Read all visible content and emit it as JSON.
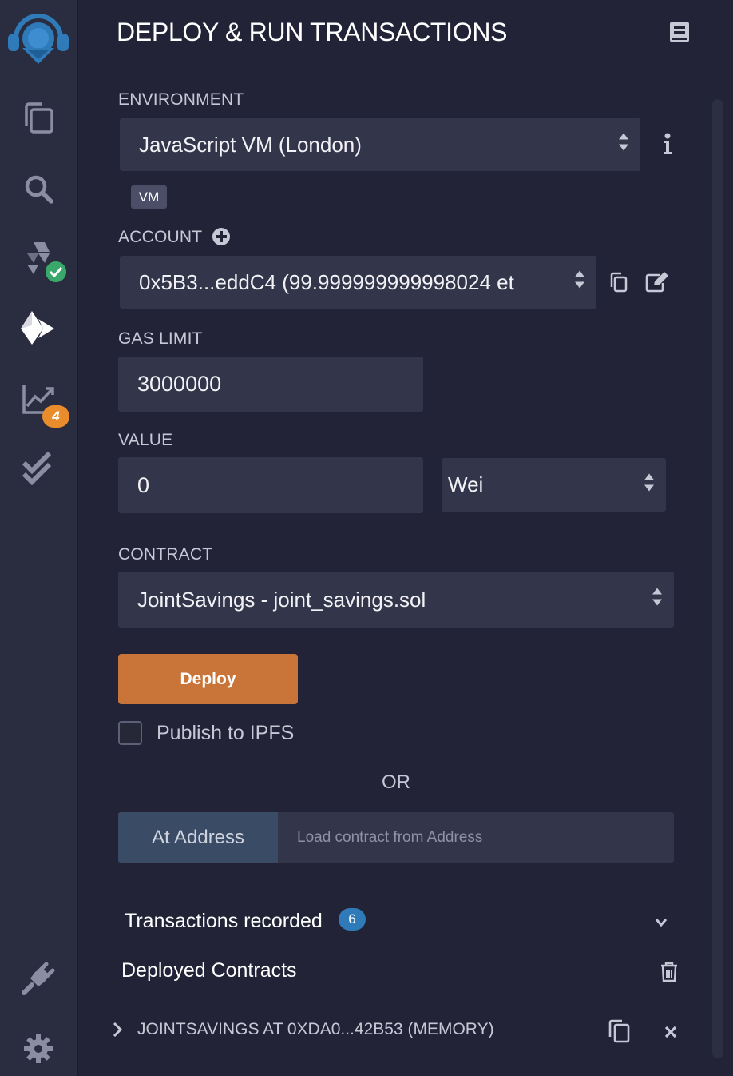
{
  "sidebar": {
    "items": [
      {
        "name": "logo"
      },
      {
        "name": "file-explorer"
      },
      {
        "name": "search"
      },
      {
        "name": "solidity-compiler"
      },
      {
        "name": "deploy-run"
      },
      {
        "name": "analysis",
        "badge": "4"
      },
      {
        "name": "unit-testing"
      },
      {
        "name": "plugin-manager"
      },
      {
        "name": "settings"
      }
    ]
  },
  "header": {
    "title": "DEPLOY & RUN TRANSACTIONS"
  },
  "environment": {
    "label": "ENVIRONMENT",
    "value": "JavaScript VM (London)",
    "badge": "VM"
  },
  "account": {
    "label": "ACCOUNT",
    "value": "0x5B3...eddC4 (99.999999999998024 et"
  },
  "gas_limit": {
    "label": "GAS LIMIT",
    "value": "3000000"
  },
  "value": {
    "label": "VALUE",
    "amount": "0",
    "unit": "Wei"
  },
  "contract": {
    "label": "CONTRACT",
    "value": "JointSavings - joint_savings.sol"
  },
  "deploy": {
    "label": "Deploy",
    "publish_label": "Publish to IPFS",
    "or_label": "OR"
  },
  "at_address": {
    "label": "At Address",
    "placeholder": "Load contract from Address"
  },
  "transactions": {
    "label": "Transactions recorded",
    "count": "6"
  },
  "deployed": {
    "label": "Deployed Contracts",
    "item": "JOINTSAVINGS AT 0XDA0...42B53 (MEMORY)"
  },
  "colors": {
    "accent": "#c97539",
    "badge_blue": "#2f7ab8",
    "badge_orange": "#e98c2c",
    "bg": "#222336"
  }
}
